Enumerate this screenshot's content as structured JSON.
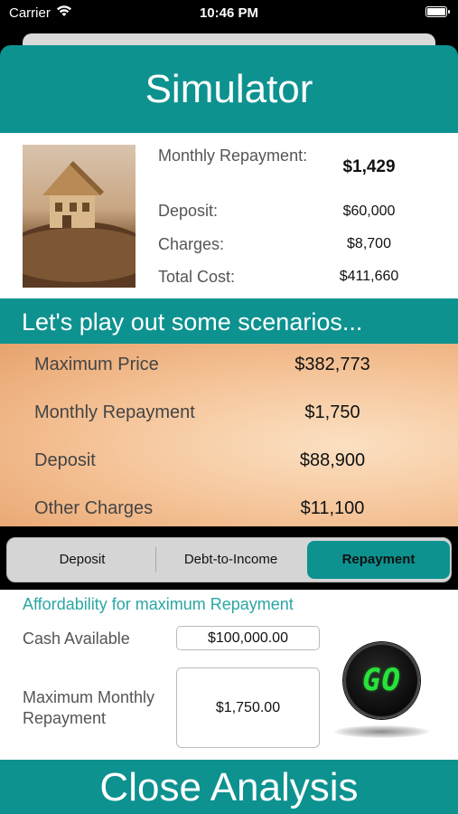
{
  "status_bar": {
    "carrier": "Carrier",
    "time": "10:46 PM"
  },
  "header": {
    "title": "Simulator"
  },
  "summary": {
    "image_icon": "house-photo",
    "rows": [
      {
        "label": "Monthly Repayment:",
        "value": "$1,429"
      },
      {
        "label": "Deposit:",
        "value": "$60,000"
      },
      {
        "label": "Charges:",
        "value": "$8,700"
      },
      {
        "label": "Total Cost:",
        "value": "$411,660"
      }
    ]
  },
  "scenarios": {
    "banner": "Let's play out some scenarios...",
    "rows": [
      {
        "label": "Maximum Price",
        "value": "$382,773"
      },
      {
        "label": "Monthly Repayment",
        "value": "$1,750"
      },
      {
        "label": "Deposit",
        "value": "$88,900"
      },
      {
        "label": "Other Charges",
        "value": "$11,100"
      }
    ]
  },
  "tabs": [
    {
      "label": "Deposit",
      "selected": false
    },
    {
      "label": "Debt-to-Income",
      "selected": false
    },
    {
      "label": "Repayment",
      "selected": true
    }
  ],
  "affordability": {
    "title": "Affordability for maximum Repayment",
    "cash_label": "Cash Available",
    "cash_value": "$100,000.00",
    "max_label": "Maximum Monthly Repayment",
    "max_value": "$1,750.00",
    "go_label": "GO"
  },
  "footer": {
    "button_label": "Close Analysis"
  },
  "colors": {
    "accent": "#0d9290",
    "accent_text": "#2aa6a4",
    "go_green": "#27e33a"
  }
}
